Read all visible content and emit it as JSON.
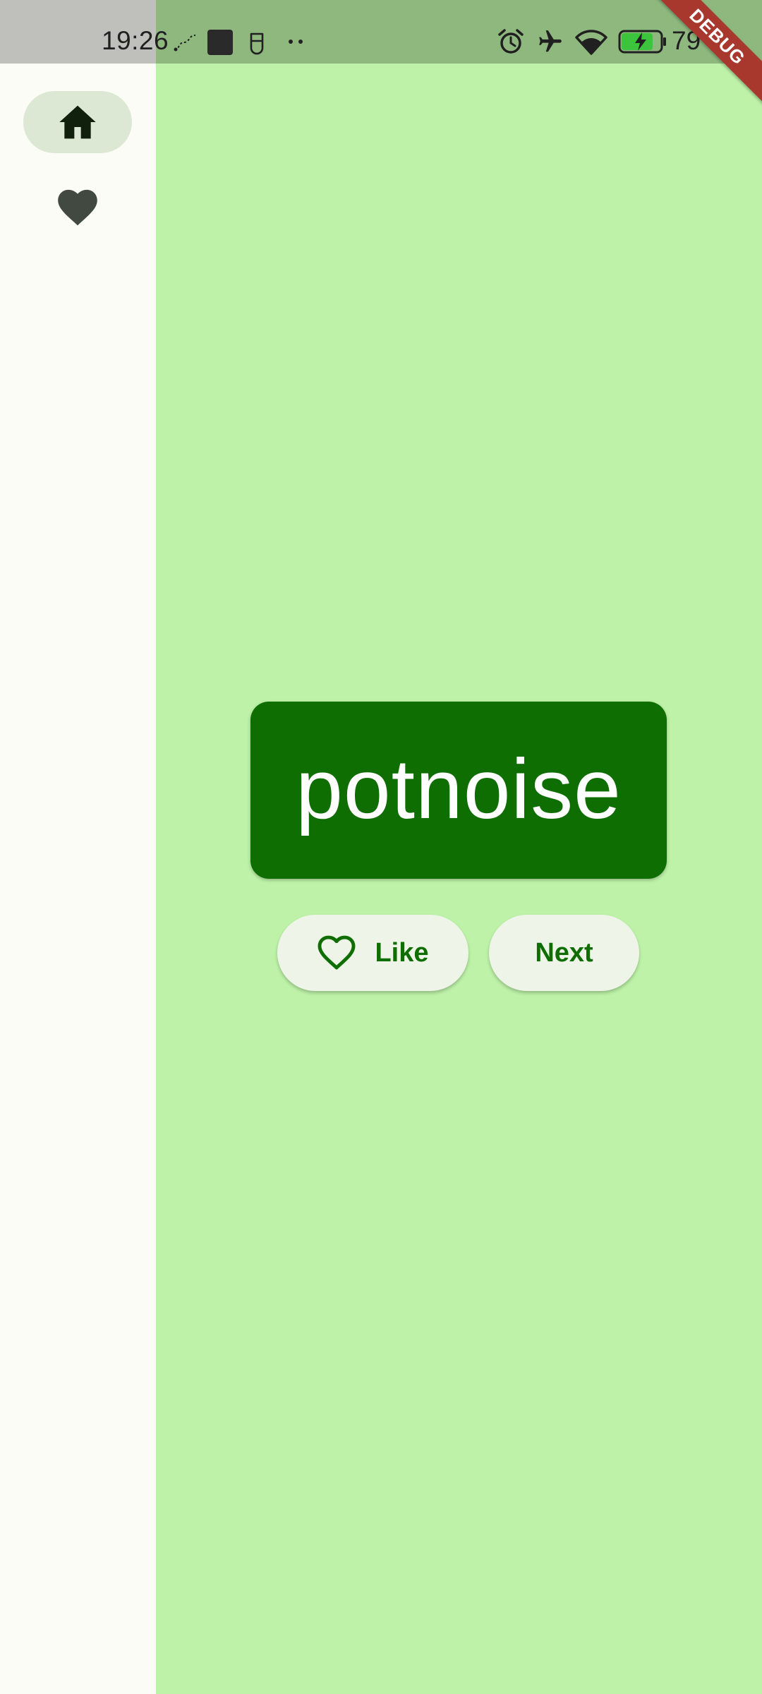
{
  "status_bar": {
    "time": "19:26",
    "battery_percent": "79",
    "icons": [
      "route-icon",
      "app-thumbnail-icon",
      "hand-icon",
      "more-dots-icon",
      "alarm-icon",
      "airplane-mode-icon",
      "wifi-icon",
      "battery-charging-icon"
    ]
  },
  "debug_banner": {
    "label": "DEBUG"
  },
  "nav_rail": {
    "items": [
      {
        "icon": "home-icon",
        "selected": true
      },
      {
        "icon": "heart-icon",
        "selected": false
      }
    ]
  },
  "main": {
    "word": "potnoise",
    "like_button": {
      "label": "Like",
      "icon": "heart-outline-icon"
    },
    "next_button": {
      "label": "Next"
    }
  },
  "colors": {
    "background": "#bdf2a8",
    "rail": "#fbfcf6",
    "card": "#0f6e02",
    "button_bg": "#eef5e8",
    "button_text": "#0f6e02",
    "nav_selected": "#dce8d4",
    "banner": "#a8382d"
  }
}
